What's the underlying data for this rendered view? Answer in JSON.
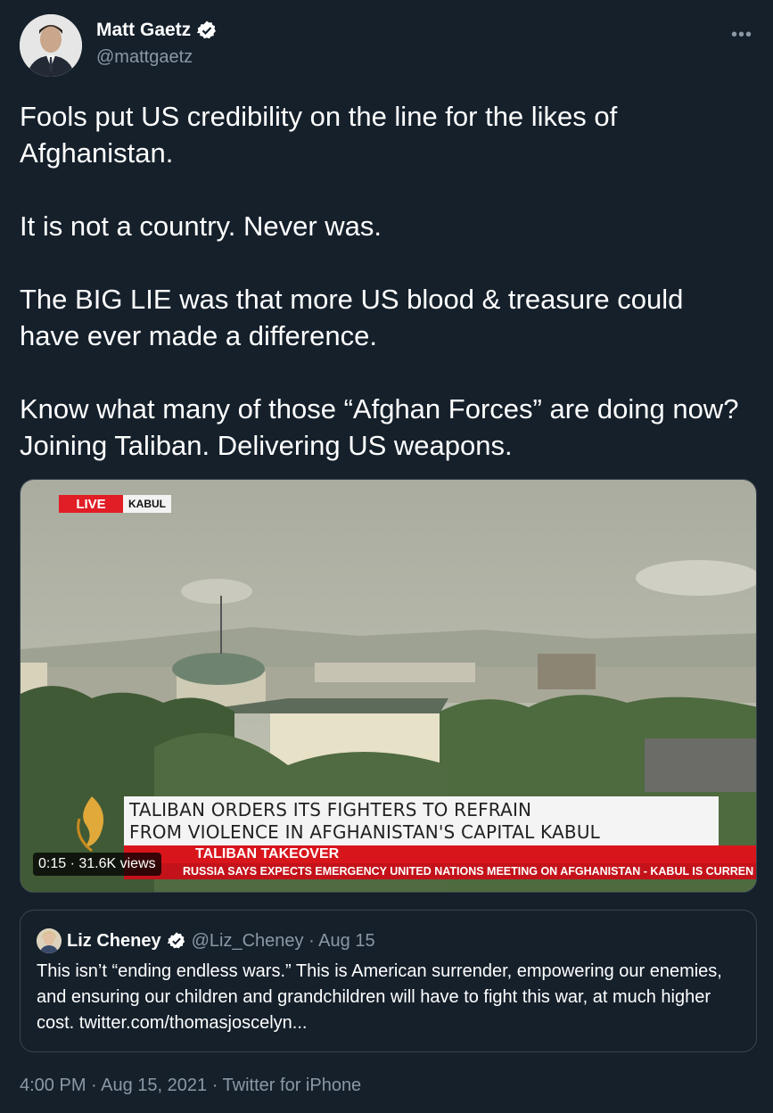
{
  "author": {
    "name": "Matt Gaetz",
    "handle": "@mattgaetz",
    "verified": true
  },
  "more_icon": "•••",
  "tweet": {
    "paragraphs": [
      "Fools put US credibility on the line for the likes of Afghanistan.",
      "It is not a country. Never was.",
      "The BIG LIE was that more US blood & treasure could have ever made a difference.",
      "Know what many of those “Afghan Forces” are doing now? Joining Taliban.  Delivering US weapons."
    ]
  },
  "video": {
    "live_label": "LIVE",
    "location_label": "KABUL",
    "headline_line1": "TALIBAN ORDERS ITS FIGHTERS TO REFRAIN",
    "headline_line2": "FROM VIOLENCE IN AFGHANISTAN'S CAPITAL KABUL",
    "banner": "TALIBAN TAKEOVER",
    "ticker": "RUSSIA SAYS EXPECTS EMERGENCY UNITED NATIONS MEETING ON AFGHANISTAN   -   KABUL IS CURREN",
    "stats": "0:15 · 31.6K views",
    "sky_color": "#b9bcae",
    "tree_color": "#4e6a3f"
  },
  "quoted": {
    "name": "Liz Cheney",
    "handle_and_date": "@Liz_Cheney · Aug 15",
    "text": "This isn’t “ending endless wars.” This is American surrender, empowering our enemies, and ensuring our children and grandchildren will have to fight this war, at much higher cost. twitter.com/thomasjoscelyn..."
  },
  "footer": "4:00 PM · Aug 15, 2021 · Twitter for iPhone",
  "colors": {
    "background": "#15202b",
    "secondary_text": "#8b98a5",
    "border": "#38444d",
    "accent_red": "#d9151c"
  }
}
